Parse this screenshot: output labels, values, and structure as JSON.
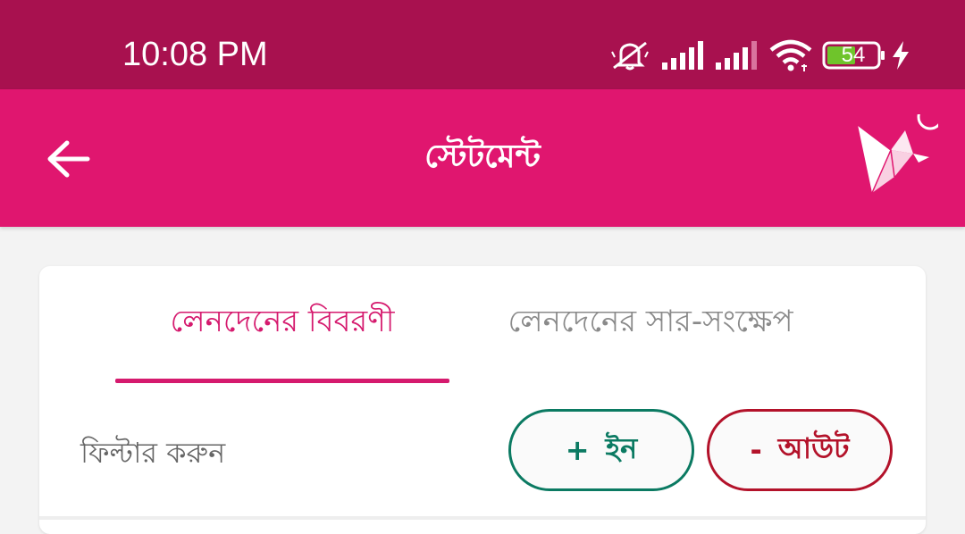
{
  "status_bar": {
    "time": "10:08 PM",
    "battery_level": "54",
    "icons": [
      "mute-icon",
      "signal-icon",
      "signal-weak-icon",
      "wifi-icon",
      "battery-icon",
      "charging-icon"
    ]
  },
  "app_bar": {
    "title": "স্টেটমেন্ট",
    "back_icon": "back-arrow-icon",
    "logo_icon": "origami-bird-logo"
  },
  "tabs": {
    "details_label": "লেনদেনের বিবরণী",
    "summary_label": "লেনদেনের সার-সংক্ষেপ",
    "active": "details"
  },
  "filter": {
    "label": "ফিল্টার করুন",
    "in_sign": "+",
    "in_label": "ইন",
    "out_sign": "-",
    "out_label": "আউট"
  },
  "colors": {
    "status_bar": "#a8114f",
    "app_bar": "#e0166f",
    "accent": "#d51a6e",
    "in_green": "#0b7a62",
    "out_red": "#b3122a",
    "battery_green": "#6fc42b"
  }
}
